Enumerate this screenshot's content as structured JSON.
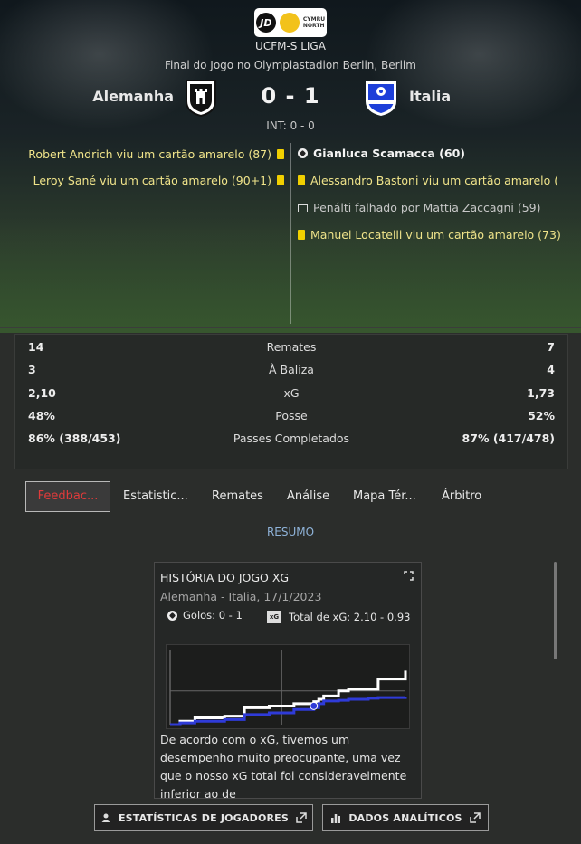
{
  "header": {
    "logo_text_top": "CYMRU",
    "logo_text_bottom": "NORTH",
    "logo_jd": "JD",
    "league": "UCFM-S LIGA",
    "venue": "Final do Jogo no Olympiastadion Berlin, Berlim",
    "home_team": "Alemanha",
    "away_team": "Italia",
    "score": "0 - 1",
    "half_time": "INT: 0 - 0"
  },
  "events": {
    "home": [
      {
        "text": "Robert Andrich viu um cartão amarelo (87)",
        "icon": "yellow-card-icon"
      },
      {
        "text": "Leroy Sané viu um cartão amarelo (90+1)",
        "icon": "yellow-card-icon"
      }
    ],
    "away": [
      {
        "text": "Gianluca Scamacca (60)",
        "icon": "goal-ball-icon"
      },
      {
        "text": "Alessandro Bastoni viu um cartão amarelo (",
        "icon": "yellow-card-icon"
      },
      {
        "text": "Penálti falhado por Mattia Zaccagni (59)",
        "icon": "missed-penalty-icon"
      },
      {
        "text": "Manuel Locatelli viu um cartão amarelo (73)",
        "icon": "yellow-card-icon"
      }
    ]
  },
  "stats": [
    {
      "home": "14",
      "label": "Remates",
      "away": "7"
    },
    {
      "home": "3",
      "label": "À Baliza",
      "away": "4"
    },
    {
      "home": "2,10",
      "label": "xG",
      "away": "1,73"
    },
    {
      "home": "48%",
      "label": "Posse",
      "away": "52%"
    },
    {
      "home": "86% (388/453)",
      "label": "Passes Completados",
      "away": "87% (417/478)"
    }
  ],
  "tabs": [
    {
      "label": "Feedbac...",
      "active": true
    },
    {
      "label": "Estatistic...",
      "active": false
    },
    {
      "label": "Remates",
      "active": false
    },
    {
      "label": "Análise",
      "active": false
    },
    {
      "label": "Mapa Tér...",
      "active": false
    },
    {
      "label": "Árbitro",
      "active": false
    }
  ],
  "section_label": "RESUMO",
  "card": {
    "title": "HISTÓRIA DO JOGO XG",
    "subtitle": "Alemanha - Italia, 17/1/2023",
    "goals": "Golos: 0 - 1",
    "xg_icon": "xG",
    "xg_total": "Total de xG: 2.10 - 0.93",
    "description": "De acordo com o xG, tivemos um desempenho muito preocupante, uma vez que o nosso xG total foi consideravelmente inferior ao de"
  },
  "chart_data": {
    "type": "line",
    "title": "",
    "xlabel": "",
    "ylabel": "",
    "xlim": [
      0,
      95
    ],
    "ylim": [
      0,
      2.2
    ],
    "series": [
      {
        "color": "#ffffff",
        "x": [
          0,
          4,
          10,
          22,
          30,
          40,
          50,
          58,
          60,
          62,
          68,
          72,
          80,
          84,
          95
        ],
        "y": [
          0.0,
          0.1,
          0.2,
          0.25,
          0.5,
          0.55,
          0.62,
          0.68,
          0.75,
          0.85,
          1.0,
          1.05,
          1.05,
          1.35,
          1.6
        ]
      },
      {
        "color": "#2f3bd8",
        "x": [
          0,
          4,
          10,
          22,
          30,
          40,
          50,
          58,
          60,
          62,
          68,
          72,
          80,
          84,
          95
        ],
        "y": [
          0.0,
          0.05,
          0.1,
          0.15,
          0.3,
          0.35,
          0.45,
          0.5,
          0.62,
          0.7,
          0.72,
          0.75,
          0.78,
          0.8,
          0.82
        ]
      }
    ],
    "markers": [
      {
        "x": 58,
        "label": "goal"
      }
    ],
    "reference_lines": {
      "x": 45,
      "y": 1.0
    },
    "colors": {
      "home": "#ffffff",
      "away": "#2f3bd8"
    }
  },
  "buttons": {
    "players_stats": "ESTATÍSTICAS DE JOGADORES",
    "analytics": "DADOS ANALÍTICOS"
  },
  "colors": {
    "active_tab_text": "#e03b3b",
    "yellow_card": "#f1d000",
    "section_label": "#8fb3d9"
  }
}
